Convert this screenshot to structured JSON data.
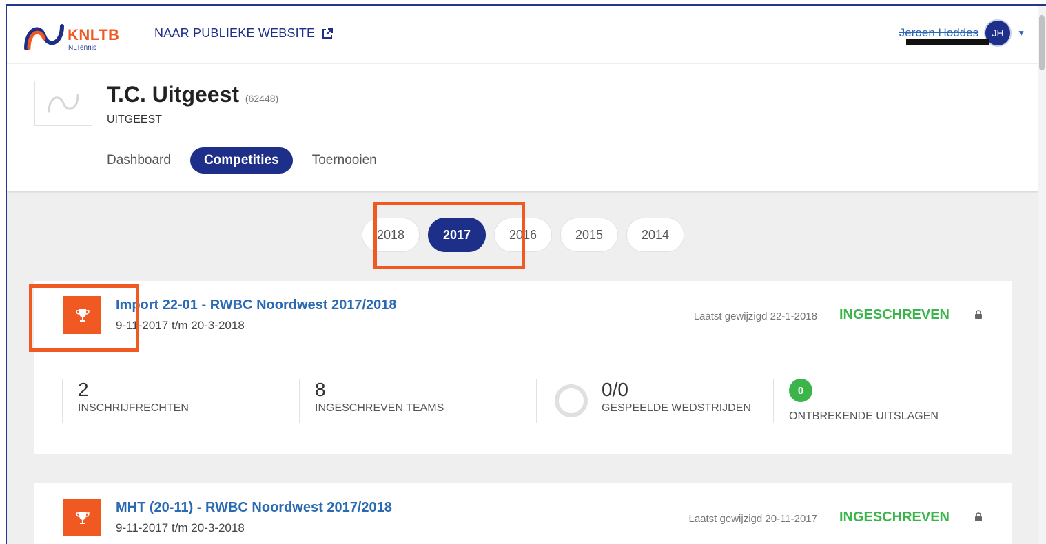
{
  "header": {
    "logo_text": "KNLTB",
    "logo_sub": "NLTennis",
    "public_link": "NAAR PUBLIEKE WEBSITE",
    "user_name": "Jeroen Hoddes",
    "user_initials": "JH"
  },
  "club": {
    "name": "T.C. Uitgeest",
    "id": "(62448)",
    "city": "UITGEEST"
  },
  "tabs": [
    {
      "label": "Dashboard",
      "active": false
    },
    {
      "label": "Competities",
      "active": true
    },
    {
      "label": "Toernooien",
      "active": false
    }
  ],
  "years": [
    {
      "label": "2018",
      "active": false
    },
    {
      "label": "2017",
      "active": true
    },
    {
      "label": "2016",
      "active": false
    },
    {
      "label": "2015",
      "active": false
    },
    {
      "label": "2014",
      "active": false
    }
  ],
  "competitions": [
    {
      "title": "Import 22-01 - RWBC Noordwest 2017/2018",
      "dates": "9-11-2017 t/m 20-3-2018",
      "last_modified": "Laatst gewijzigd 22-1-2018",
      "status": "INGESCHREVEN",
      "stats": {
        "inschrijfrechten": {
          "value": "2",
          "label": "INSCHRIJFRECHTEN"
        },
        "teams": {
          "value": "8",
          "label": "INGESCHREVEN TEAMS"
        },
        "matches": {
          "value": "0/0",
          "label": "GESPEELDE WEDSTRIJDEN"
        },
        "missing": {
          "value": "0",
          "label": "ONTBREKENDE UITSLAGEN"
        }
      }
    },
    {
      "title": "MHT (20-11) - RWBC Noordwest 2017/2018",
      "dates": "9-11-2017 t/m 20-3-2018",
      "last_modified": "Laatst gewijzigd 20-11-2017",
      "status": "INGESCHREVEN"
    }
  ],
  "colors": {
    "brand_blue": "#1e2f8a",
    "brand_orange": "#f05a22",
    "status_green": "#3bb54a",
    "link_blue": "#2a6ab3"
  }
}
